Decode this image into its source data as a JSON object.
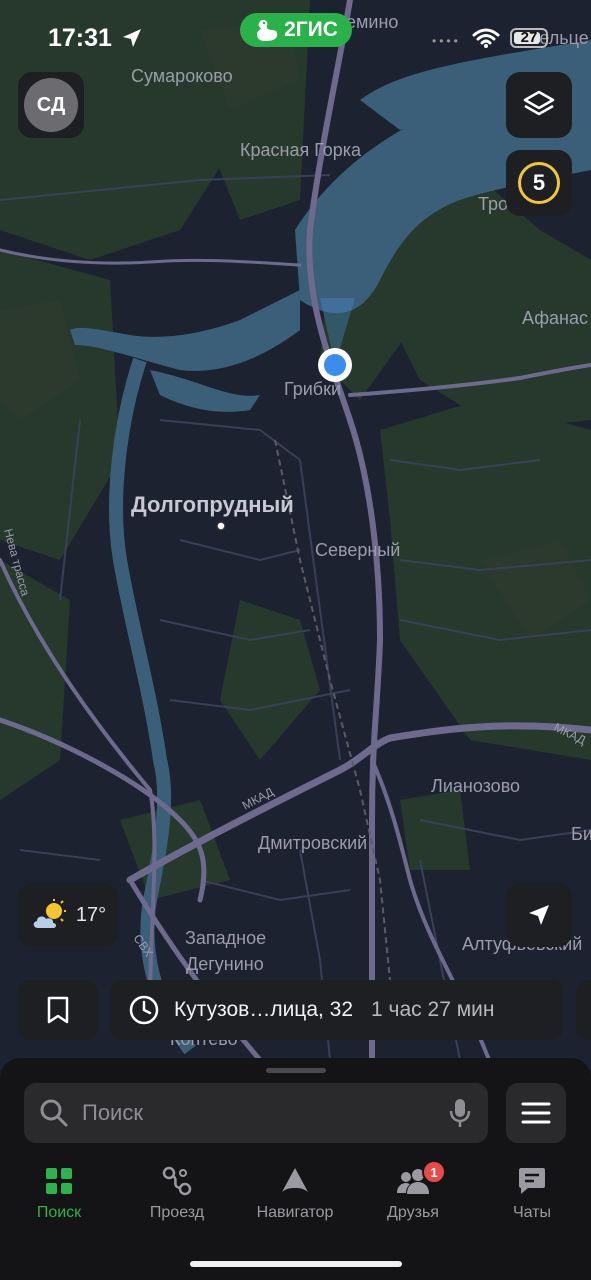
{
  "status_bar": {
    "time": "17:31",
    "brand": "2ГИС",
    "battery": "27"
  },
  "profile": {
    "initials": "СД"
  },
  "map": {
    "labels": {
      "sumarokovo": "Сумароково",
      "krasnaya_gorka": "Красная Горка",
      "gribki": "Грибки",
      "dolgoprudny": "Долгопрудный",
      "severny": "Северный",
      "lianozovo": "Лианозово",
      "dmitrovsky": "Дмитровский",
      "zapadnoe": "Западное",
      "degunino": "Дегунино",
      "afanas": "Афанас",
      "tro": "Тро",
      "bi": "Би",
      "emino": "емино",
      "velce": "овельце",
      "altufyevsky": "Алтуфьевский",
      "mkad_1": "МКАД",
      "mkad_2": "МКАД",
      "svh": "СВХ",
      "koptevo": "Коптево",
      "neva": "Нева трасса"
    },
    "colors": {
      "background": "#1d2230",
      "forest": "#26392c",
      "water": "#3b5f78",
      "road": "#6e6a8e",
      "accent": "#2eb24b"
    }
  },
  "controls": {
    "layers_icon": "layers-icon",
    "traffic_score": "5",
    "weather_temp": "17°",
    "weather_icon": "sun-cloud-icon",
    "locate_icon": "navigation-arrow-icon"
  },
  "route_chip": {
    "address": "Кутузов…лица, 32",
    "duration": "1 час 27 мин"
  },
  "search": {
    "placeholder": "Поиск"
  },
  "tabs": [
    {
      "label": "Поиск",
      "icon": "grid-icon",
      "active": true
    },
    {
      "label": "Проезд",
      "icon": "route-icon"
    },
    {
      "label": "Навигатор",
      "icon": "navigator-icon"
    },
    {
      "label": "Друзья",
      "icon": "friends-icon",
      "badge": "1"
    },
    {
      "label": "Чаты",
      "icon": "chat-icon"
    }
  ]
}
